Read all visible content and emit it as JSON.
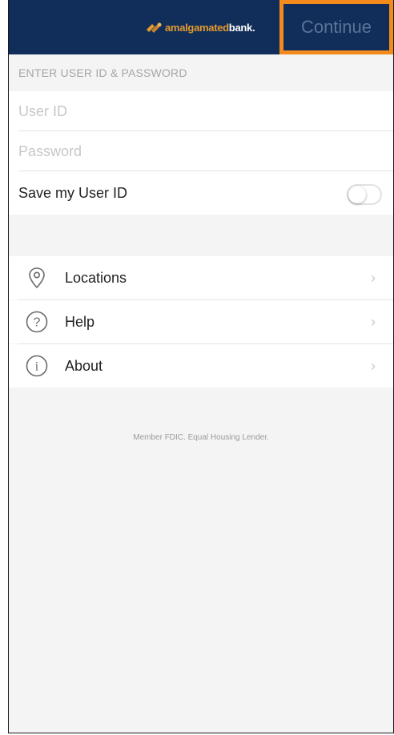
{
  "header": {
    "logo_text_part1": "amalgamated",
    "logo_text_part2": "bank.",
    "continue_label": "Continue"
  },
  "login": {
    "section_title": "ENTER USER ID & PASSWORD",
    "user_id_placeholder": "User ID",
    "user_id_value": "",
    "password_placeholder": "Password",
    "password_value": "",
    "save_label": "Save my User ID",
    "save_toggle_on": false
  },
  "menu": {
    "items": [
      {
        "label": "Locations",
        "icon": "location-pin-icon"
      },
      {
        "label": "Help",
        "icon": "question-circle-icon"
      },
      {
        "label": "About",
        "icon": "info-circle-icon"
      }
    ]
  },
  "footer": {
    "text": "Member FDIC. Equal Housing Lender."
  },
  "colors": {
    "navbar": "#112e5b",
    "accent_orange": "#f28a1c",
    "logo_gold": "#e39a2d"
  }
}
